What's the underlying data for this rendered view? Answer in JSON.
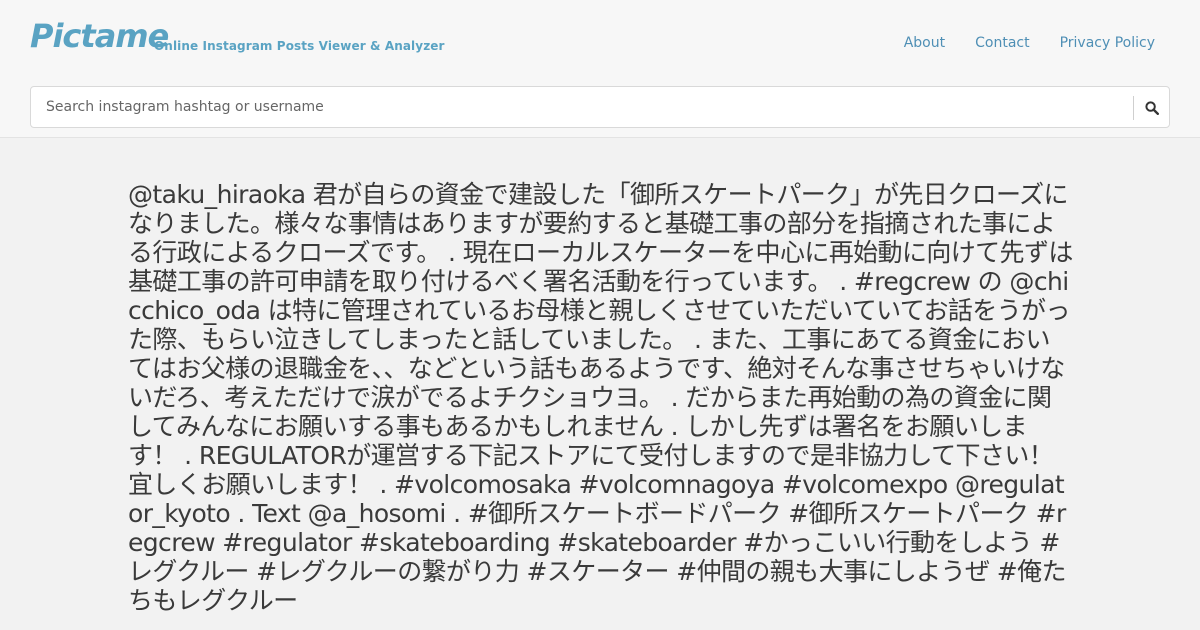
{
  "header": {
    "logo": "Pictame",
    "tagline": "Online Instagram Posts Viewer & Analyzer",
    "nav": [
      "About",
      "Contact",
      "Privacy Policy"
    ]
  },
  "search": {
    "placeholder": "Search instagram hashtag or username",
    "icon": "search-icon"
  },
  "post": {
    "caption": "@taku_hiraoka 君が自らの資金で建設した「御所スケートパーク」が先日クローズになりました。様々な事情はありますが要約すると基礎工事の部分を指摘された事による行政によるクローズです。 . 現在ローカルスケーターを中心に再始動に向けて先ずは基礎工事の許可申請を取り付けるべく署名活動を行っています。 . #regcrew の @chicchico_oda は特に管理されているお母様と親しくさせていただいていてお話をうがった際、もらい泣きしてしまったと話していました。 . また、工事にあてる資金においてはお父様の退職金を、、などという話もあるようです、絶対そんな事させちゃいけないだろ、考えただけで涙がでるよチクショウヨ。 . だからまた再始動の為の資金に関してみんなにお願いする事もあるかもしれません . しかし先ずは署名をお願いします！ . REGULATORが運営する下記ストアにて受付しますので是非協力して下さい！宜しくお願いします！ . #volcomosaka #volcomnagoya #volcomexpo @regulator_kyoto . Text @a_hosomi . #御所スケートボードパーク #御所スケートパーク #regcrew #regulator #skateboarding #skateboarder #かっこいい行動をしよう #レグクルー #レグクルーの繋がり力 #スケーター #仲間の親も大事にしようぜ #俺たちもレグクルー"
  }
}
